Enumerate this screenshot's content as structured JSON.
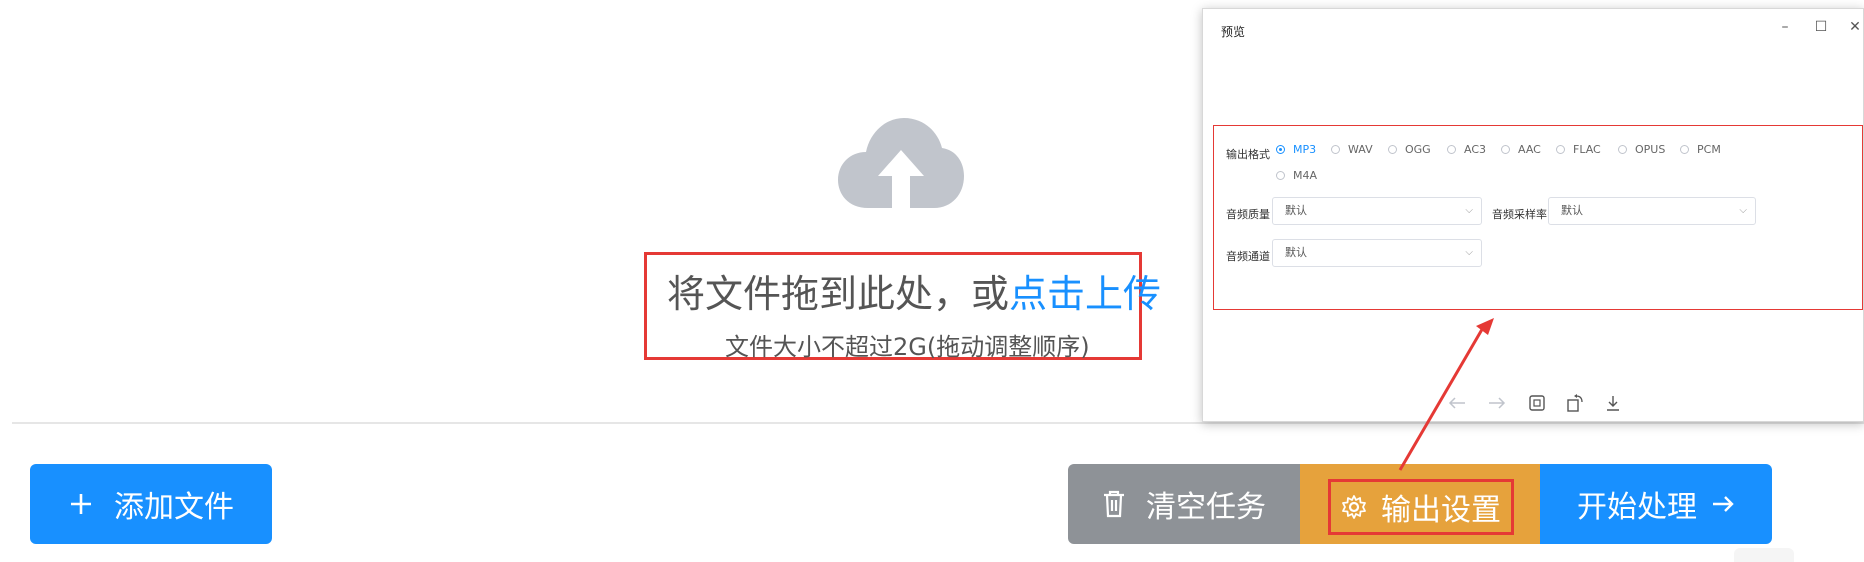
{
  "upload": {
    "drop_prefix": "将文件拖到此处，或",
    "drop_link": "点击上传",
    "hint": "文件大小不超过2G(拖动调整顺序)"
  },
  "buttons": {
    "add_label": "添加文件",
    "clear_label": "清空任务",
    "output_label": "输出设置",
    "start_label": "开始处理"
  },
  "preview": {
    "title": "预览",
    "format_label": "输出格式",
    "formats": [
      "MP3",
      "WAV",
      "OGG",
      "AC3",
      "AAC",
      "FLAC",
      "OPUS",
      "PCM",
      "M4A"
    ],
    "selected_format": "MP3",
    "quality_label": "音频质量",
    "quality_value": "默认",
    "samplerate_label": "音频采样率",
    "samplerate_value": "默认",
    "channel_label": "音频通道",
    "channel_value": "默认"
  },
  "colors": {
    "primary": "#1890ff",
    "clear_btn": "#8e9297",
    "output_btn": "#e6a23c",
    "annotation": "#e53935"
  }
}
